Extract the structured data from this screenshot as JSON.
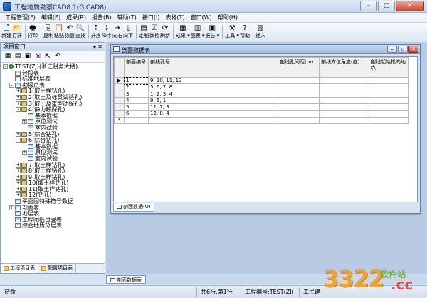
{
  "window": {
    "title": "工程地质勘察CAD8.1(GICAD8)"
  },
  "menu": [
    "工程管理(F)",
    "编辑(E)",
    "成果(R)",
    "报告(B)",
    "辅助(T)",
    "接口(I)",
    "表格(T)",
    "窗口(W)",
    "帮助(H)"
  ],
  "toolbar": [
    {
      "label": "新建",
      "icon": "new-file-icon",
      "glyph": "🗋"
    },
    {
      "label": "打开",
      "icon": "open-folder-icon",
      "glyph": "📂"
    },
    {
      "sep": true
    },
    {
      "label": "打印",
      "icon": "print-icon",
      "glyph": "🖶"
    },
    {
      "sep": true
    },
    {
      "label": "复制",
      "icon": "copy-icon",
      "glyph": "⎘"
    },
    {
      "label": "粘贴",
      "icon": "paste-icon",
      "glyph": "📋"
    },
    {
      "label": "恢复",
      "icon": "undo-icon",
      "glyph": "↶"
    },
    {
      "label": "查找",
      "icon": "find-icon",
      "glyph": "🔍"
    },
    {
      "sep": true
    },
    {
      "label": "升序",
      "icon": "sort-asc-icon",
      "glyph": "⇡"
    },
    {
      "label": "降序",
      "icon": "sort-desc-icon",
      "glyph": "⇣"
    },
    {
      "label": "向右",
      "icon": "move-right-icon",
      "glyph": "⇥"
    },
    {
      "label": "向下",
      "icon": "move-down-icon",
      "glyph": "⤓"
    },
    {
      "sep": true
    },
    {
      "label": "定制",
      "icon": "customize-icon",
      "glyph": "▤"
    },
    {
      "label": "数检",
      "icon": "data-check-icon",
      "glyph": "☑"
    },
    {
      "label": "刷新",
      "icon": "refresh-icon",
      "glyph": "⟳"
    },
    {
      "sep": true
    },
    {
      "label": "成果 ▾",
      "icon": "results-icon",
      "glyph": "▦"
    },
    {
      "label": "图表 ▾",
      "icon": "chart-icon",
      "glyph": "▥"
    },
    {
      "label": "报告 ▾",
      "icon": "report-icon",
      "glyph": "▣"
    },
    {
      "sep": true
    },
    {
      "label": "工具 ▾",
      "icon": "tools-icon",
      "glyph": "⚒"
    },
    {
      "label": "帮助",
      "icon": "help-icon",
      "glyph": "?"
    },
    {
      "sep": true
    },
    {
      "label": "插入",
      "icon": "insert-icon",
      "glyph": "▧"
    }
  ],
  "project_pane": {
    "title": "项目窗口",
    "tree": [
      {
        "level": 0,
        "exp": "-",
        "icon": "root",
        "text": "TEST(ZJ)(浙江税务大楼)"
      },
      {
        "level": 1,
        "exp": "",
        "icon": "table",
        "text": "分段表"
      },
      {
        "level": 1,
        "exp": "",
        "icon": "table",
        "text": "标准地层表"
      },
      {
        "level": 1,
        "exp": "-",
        "icon": "table",
        "text": "勘探点表"
      },
      {
        "level": 2,
        "exp": "+",
        "icon": "hole",
        "text": "1(取土样钻孔)"
      },
      {
        "level": 2,
        "exp": "+",
        "icon": "hole",
        "text": "2(取土及标贯试验孔)"
      },
      {
        "level": 2,
        "exp": "+",
        "icon": "hole",
        "text": "3(取土及重型动探孔)"
      },
      {
        "level": 2,
        "exp": "-",
        "icon": "hole",
        "text": "4(静力触探孔)"
      },
      {
        "level": 3,
        "exp": "",
        "icon": "table",
        "text": "基本数据"
      },
      {
        "level": 3,
        "exp": "+",
        "icon": "table",
        "text": "原位测试"
      },
      {
        "level": 3,
        "exp": "",
        "icon": "table",
        "text": "室内试验"
      },
      {
        "level": 2,
        "exp": "+",
        "icon": "hole",
        "text": "5(综合钻孔)"
      },
      {
        "level": 2,
        "exp": "-",
        "icon": "hole",
        "text": "6(综合钻孔)"
      },
      {
        "level": 3,
        "exp": "",
        "icon": "table",
        "text": "基本数据"
      },
      {
        "level": 3,
        "exp": "+",
        "icon": "table",
        "text": "原位测试"
      },
      {
        "level": 3,
        "exp": "",
        "icon": "table",
        "text": "室内试验"
      },
      {
        "level": 2,
        "exp": "+",
        "icon": "hole",
        "text": "7(取土样钻孔)"
      },
      {
        "level": 2,
        "exp": "+",
        "icon": "hole",
        "text": "8(取土样钻孔)"
      },
      {
        "level": 2,
        "exp": "+",
        "icon": "hole",
        "text": "9(取土样钻孔)"
      },
      {
        "level": 2,
        "exp": "+",
        "icon": "hole",
        "text": "10(取土样钻孔)"
      },
      {
        "level": 2,
        "exp": "+",
        "icon": "hole",
        "text": "11(取土样钻孔)"
      },
      {
        "level": 2,
        "exp": "+",
        "icon": "hole",
        "text": "12(钻孔)"
      },
      {
        "level": 1,
        "exp": "",
        "icon": "table",
        "text": "平面图特殊符号数据"
      },
      {
        "level": 1,
        "exp": "+",
        "icon": "table",
        "text": "剖面表"
      },
      {
        "level": 1,
        "exp": "",
        "icon": "table",
        "text": "地层表"
      },
      {
        "level": 1,
        "exp": "",
        "icon": "table",
        "text": "工程图纸目录表"
      },
      {
        "level": 1,
        "exp": "",
        "icon": "table",
        "text": "综合地质分层表"
      }
    ],
    "tabs": [
      "工程项目表",
      "配置项目表"
    ]
  },
  "child_window": {
    "title": "剖面数据表",
    "columns": [
      "剖面编号",
      "剖线孔号",
      "剖线孔间距(m)",
      "剖线方位角度(度)",
      "剖线起始指向地点"
    ],
    "rows": [
      [
        "1",
        "9, 10, 11, 12",
        "",
        "",
        ""
      ],
      [
        "2",
        "5, 6, 7, 8",
        "",
        "",
        ""
      ],
      [
        "3",
        "1, 2, 3, 4",
        "",
        "",
        ""
      ],
      [
        "4",
        "9, 5, 1",
        "",
        "",
        ""
      ],
      [
        "5",
        "11, 7, 3",
        "",
        "",
        ""
      ],
      [
        "6",
        "12, 8, 4",
        "",
        "",
        ""
      ]
    ],
    "tab": "剖面数据(U)"
  },
  "window_tab": "剖面数据表",
  "status": {
    "ready": "待命",
    "record": "共6行,第1行",
    "project": "工程编号:TEST(ZJ)",
    "type": "工民建"
  },
  "watermark": {
    "number": "3322",
    "site": "软件站",
    "tld": ".cc"
  }
}
